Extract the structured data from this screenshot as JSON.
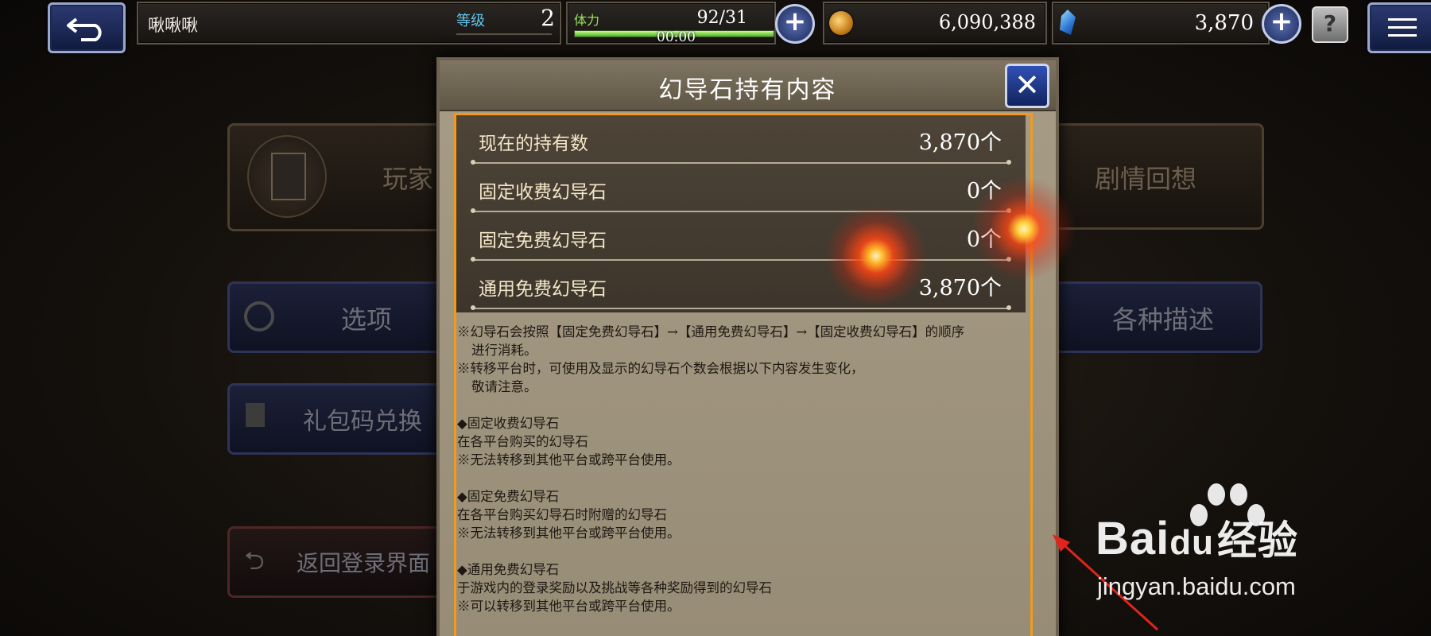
{
  "topbar": {
    "player_name": "啾啾啾",
    "level_label": "等级",
    "level_value": "2",
    "stamina_label": "体力",
    "stamina_value": "92/31",
    "stamina_timer": "00:00",
    "stamina_fill_fraction": 1.0,
    "gil_value": "6,090,388",
    "gem_value": "3,870"
  },
  "background_menu": {
    "profile_label": "玩家",
    "story_label": "剧情回想",
    "options_label": "选项",
    "describe_label": "各种描述",
    "gift_label": "礼包码兑换",
    "return_label": "返回登录界面"
  },
  "modal": {
    "title": "幻导石持有内容",
    "rows": [
      {
        "label": "现在的持有数",
        "value": "3,870个"
      },
      {
        "label": "固定收费幻导石",
        "value": "0个"
      },
      {
        "label": "固定免费幻导石",
        "value": "0个"
      },
      {
        "label": "通用免费幻导石",
        "value": "3,870个"
      }
    ],
    "notes": [
      "※幻导石会按照【固定免费幻导石】→【通用免费幻导石】→【固定收费幻导石】的顺序",
      "进行消耗。",
      "※转移平台时，可使用及显示的幻导石个数会根据以下内容发生变化，",
      "敬请注意。",
      "◆固定收费幻导石",
      "在各平台购买的幻导石",
      "※无法转移到其他平台或跨平台使用。",
      "◆固定免费幻导石",
      "在各平台购买幻导石时附赠的幻导石",
      "※无法转移到其他平台或跨平台使用。",
      "◆通用免费幻导石",
      "于游戏内的登录奖励以及挑战等各种奖励得到的幻导石",
      "※可以转移到其他平台或跨平台使用。"
    ]
  },
  "watermark": {
    "brand": "Bai",
    "brand_du": "du",
    "brand_cn": "经验",
    "url": "jingyan.baidu.com"
  },
  "colors": {
    "highlight_border": "#f39a1d",
    "level_label": "#63c7ee",
    "stamina_label": "#98e25c"
  },
  "icons": [
    "back-arrow-icon",
    "menu-icon",
    "gil-coin-icon",
    "gem-crystal-icon",
    "plus-icon",
    "help-icon",
    "close-icon",
    "gear-icon",
    "gift-icon",
    "return-arrow-icon",
    "portrait-icon"
  ]
}
